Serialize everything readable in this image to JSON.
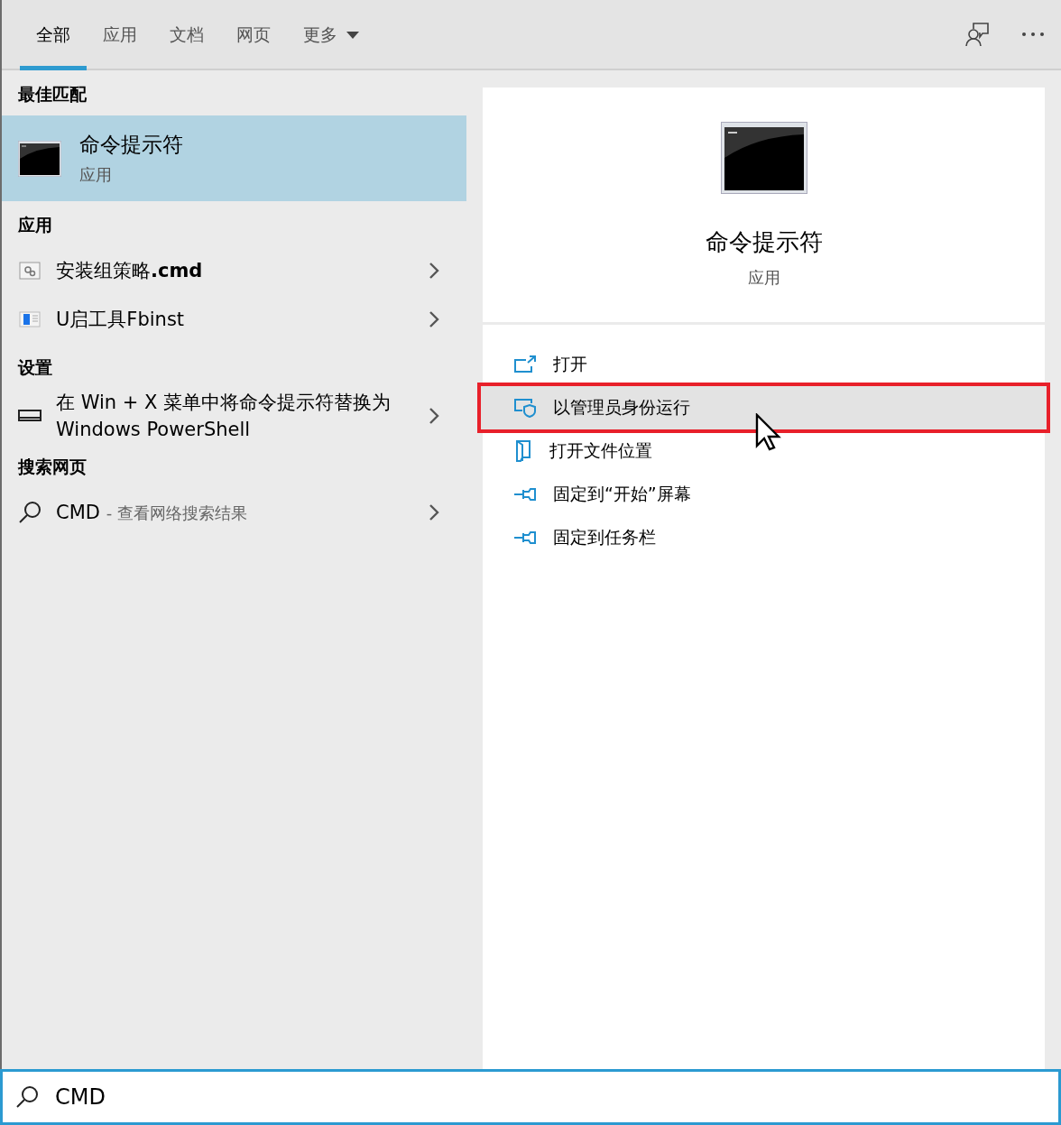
{
  "tabs": [
    {
      "label": "全部",
      "selected": true,
      "dropdown": false
    },
    {
      "label": "应用",
      "selected": false,
      "dropdown": false
    },
    {
      "label": "文档",
      "selected": false,
      "dropdown": false
    },
    {
      "label": "网页",
      "selected": false,
      "dropdown": false
    },
    {
      "label": "更多",
      "selected": false,
      "dropdown": true
    }
  ],
  "best_match": {
    "header": "最佳匹配",
    "title": "命令提示符",
    "subtitle": "应用",
    "selected": true
  },
  "sections": [
    {
      "header": "应用",
      "items": [
        {
          "kind": "script",
          "label": "安装组策略**.cmd**"
        },
        {
          "kind": "app",
          "label": "U启工具Fbinst"
        }
      ]
    },
    {
      "header": "设置",
      "items": [
        {
          "kind": "setting",
          "label": "在 Win + X 菜单中将命令提示符替换为 Windows PowerShell"
        }
      ]
    },
    {
      "header": "搜索网页",
      "items": [
        {
          "kind": "web",
          "label": "CMD",
          "detail": "- 查看网络搜索结果"
        }
      ]
    }
  ],
  "preview": {
    "title": "命令提示符",
    "subtitle": "应用"
  },
  "actions": [
    {
      "kind": "open",
      "label": "打开",
      "highlighted": false
    },
    {
      "kind": "admin",
      "label": "以管理员身份运行",
      "highlighted": true
    },
    {
      "kind": "folder",
      "label": "打开文件位置",
      "highlighted": false
    },
    {
      "kind": "pin",
      "label": "固定到“开始”屏幕",
      "highlighted": false
    },
    {
      "kind": "pin",
      "label": "固定到任务栏",
      "highlighted": false
    }
  ],
  "search": {
    "value": "CMD"
  }
}
